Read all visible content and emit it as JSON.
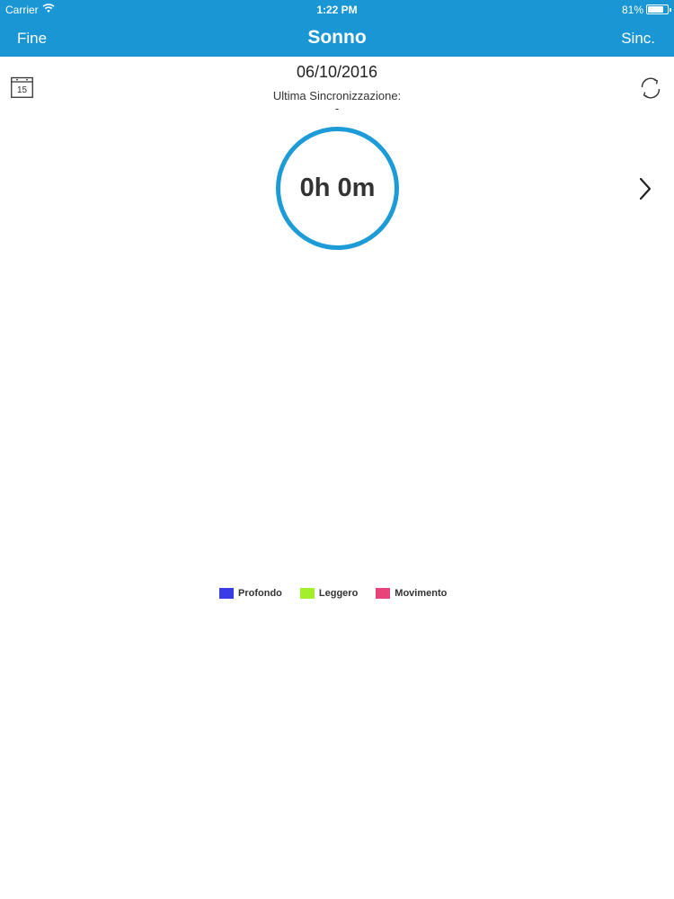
{
  "status_bar": {
    "carrier": "Carrier",
    "time": "1:22 PM",
    "battery": "81%",
    "battery_level": 0.81
  },
  "nav": {
    "left_button": "Fine",
    "title": "Sonno",
    "right_button": "Sinc."
  },
  "header": {
    "calendar_day": "15",
    "date": "06/10/2016",
    "sync_label": "Ultima Sincronizzazione:",
    "sync_value": "-"
  },
  "summary": {
    "duration": "0h 0m"
  },
  "legend": [
    {
      "label": "Profondo",
      "color": "#3a3de6"
    },
    {
      "label": "Leggero",
      "color": "#a3f02a"
    },
    {
      "label": "Movimento",
      "color": "#e8447a"
    }
  ],
  "colors": {
    "primary": "#1a96d4",
    "ring": "#1c9bd7"
  },
  "icons": {
    "calendar": "calendar-icon",
    "sync": "sync-icon",
    "next": "chevron-right-icon",
    "wifi": "wifi-icon",
    "battery": "battery-icon"
  }
}
